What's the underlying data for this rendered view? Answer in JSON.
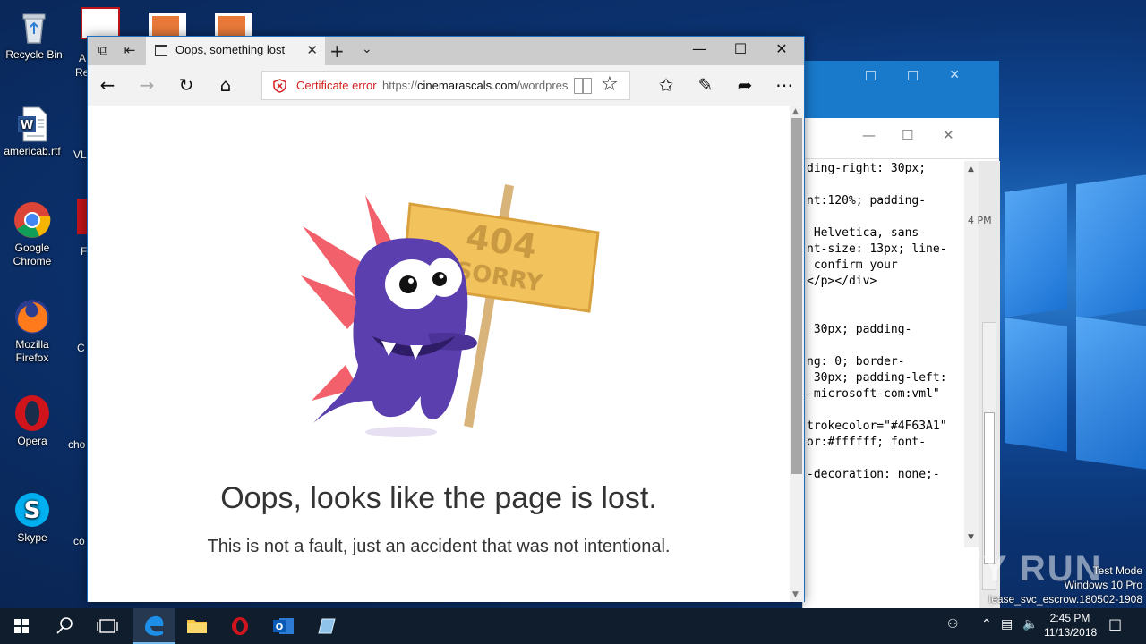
{
  "desktop": {
    "icons": [
      {
        "name": "recycle-bin",
        "label": "Recycle Bin"
      },
      {
        "name": "americab-rtf",
        "label": "americab.rtf"
      },
      {
        "name": "google-chrome",
        "label": "Google Chrome"
      },
      {
        "name": "mozilla-firefox",
        "label": "Mozilla Firefox"
      },
      {
        "name": "opera",
        "label": "Opera"
      },
      {
        "name": "skype",
        "label": "Skype"
      }
    ],
    "partial_labels": [
      "A",
      "Re",
      "VL",
      "F",
      "C",
      "cho",
      "co"
    ]
  },
  "browser": {
    "tab_title": "Oops, something lost",
    "address": {
      "cert_warning": "Certificate error",
      "url_scheme": "https://",
      "url_host": "cinemarascals.com",
      "url_path": "/wordpres"
    },
    "page": {
      "sign_top": "404",
      "sign_bottom": "SORRY",
      "heading": "Oops, looks like the page is lost.",
      "subheading": "This is not a fault, just an accident that was not intentional."
    }
  },
  "background_window": {
    "code_lines": [
      "ding-right: 30px;",
      "",
      "nt:120%; padding-",
      "",
      " Helvetica, sans-",
      "nt-size: 13px; line-",
      " confirm your",
      "</p></div>",
      "",
      "",
      " 30px; padding-",
      "",
      "ng: 0; border-",
      " 30px; padding-left:",
      "-microsoft-com:vml\"",
      "",
      "trokecolor=\"#4F63A1\"",
      "or:#ffffff; font-",
      "",
      "-decoration: none;-"
    ],
    "side_time": "4 PM"
  },
  "taskbar": {
    "time": "2:45 PM",
    "date": "11/13/2018"
  },
  "watermark": {
    "brand": "ANY RUN",
    "test_mode": "Test Mode",
    "os": "Windows 10 Pro",
    "build": "lease_svc_escrow.180502-1908"
  },
  "colors": {
    "accent": "#0078d7",
    "cert_error": "#d42222",
    "mascot": "#5b3fae",
    "spikes": "#f2616b",
    "sign": "#f2c35c"
  }
}
